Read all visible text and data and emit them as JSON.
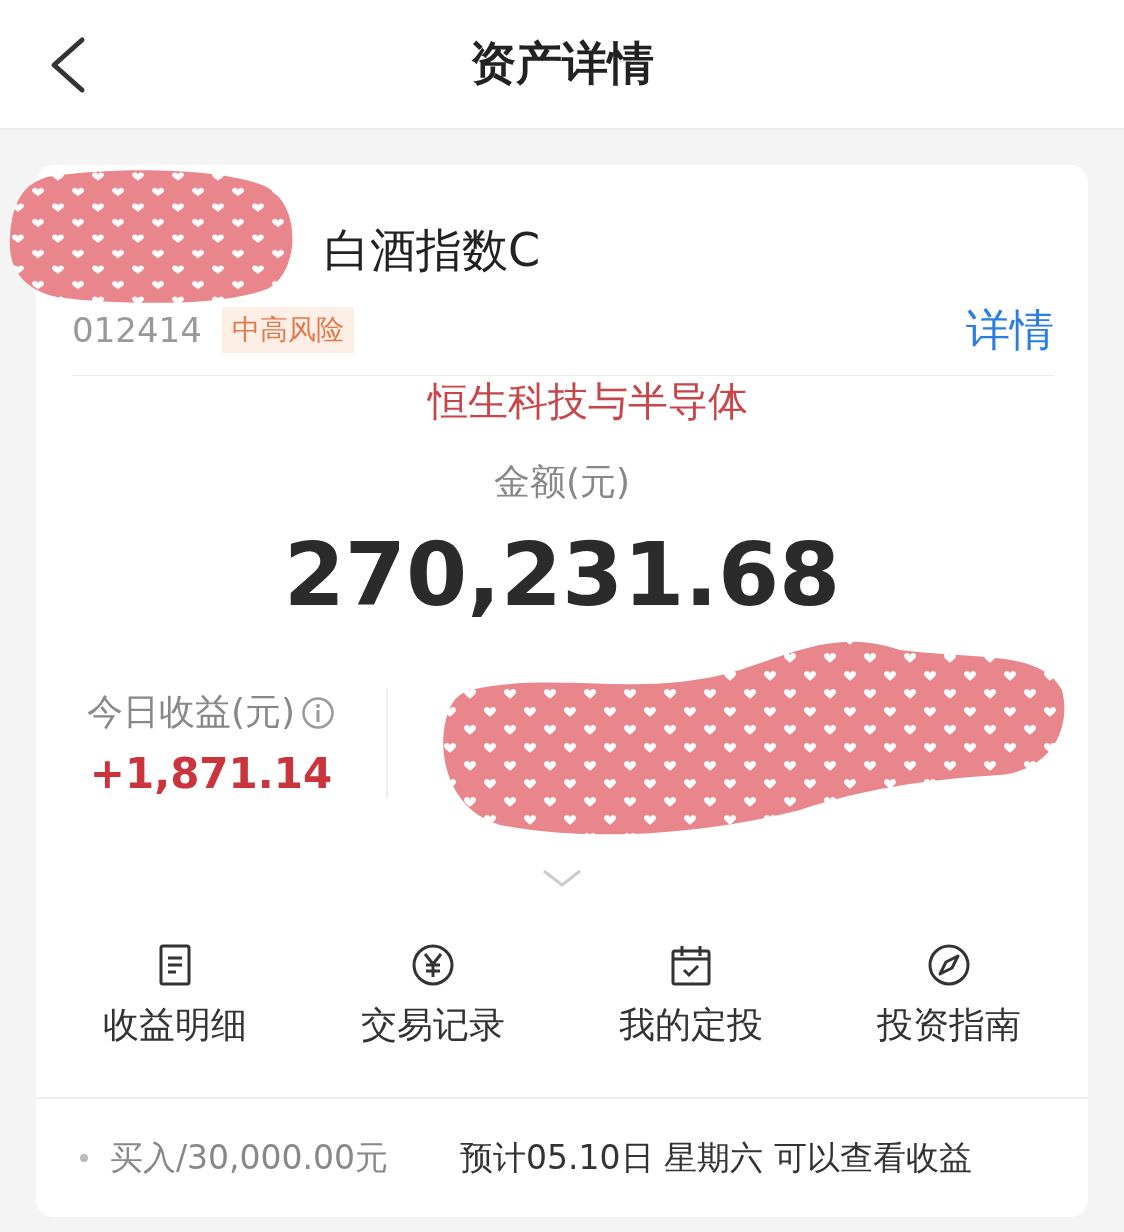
{
  "header": {
    "title": "资产详情"
  },
  "fund": {
    "name": "白酒指数C",
    "code": "012414",
    "risk_tag": "中高风险",
    "detail_link": "详情"
  },
  "annotation": "恒生科技与半导体",
  "amount": {
    "label": "金额(元)",
    "value": "270,231.68"
  },
  "stats": [
    {
      "label": "今日收益(元)",
      "value": "+1,871.14",
      "info": true
    }
  ],
  "actions": [
    {
      "label": "收益明细",
      "kind": "document"
    },
    {
      "label": "交易记录",
      "kind": "yen"
    },
    {
      "label": "我的定投",
      "kind": "calendar"
    },
    {
      "label": "投资指南",
      "kind": "compass"
    }
  ],
  "footer": {
    "purchase": "买入/30,000.00元",
    "note": "预计05.10日 星期六 可以查看收益"
  },
  "redaction_marks": [
    {
      "kind": "hearts"
    },
    {
      "kind": "hearts"
    }
  ]
}
